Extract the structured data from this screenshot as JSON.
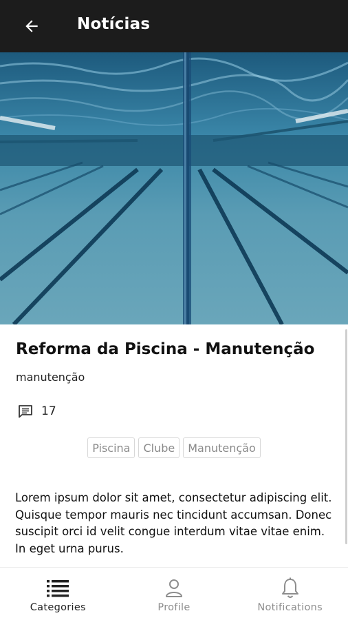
{
  "appbar": {
    "title": "Notícias",
    "back_icon": "arrow-left-icon"
  },
  "hero": {
    "image": "underwater-swimming-pool-photo",
    "tint": "#2e7397"
  },
  "article": {
    "title": "Reforma da Piscina - Manutenção",
    "category": "manutenção",
    "comment_icon": "comment-icon",
    "comment_count": "17",
    "tags": [
      "Piscina",
      "Clube",
      "Manutenção"
    ],
    "body": "Lorem ipsum dolor sit amet, consectetur adipiscing elit. Quisque tempor mauris nec tincidunt accumsan. Donec suscipit orci id velit congue interdum vitae vitae enim. In eget urna purus."
  },
  "bottom_nav": {
    "items": [
      {
        "label": "Categories",
        "icon": "list-icon",
        "active": true
      },
      {
        "label": "Profile",
        "icon": "user-icon",
        "active": false
      },
      {
        "label": "Notifications",
        "icon": "bell-icon",
        "active": false
      }
    ]
  },
  "colors": {
    "appbar": "#1c1c1c",
    "active_nav": "#222222",
    "inactive_nav": "#8d8d8d",
    "tag_border": "#d8d8d8"
  }
}
